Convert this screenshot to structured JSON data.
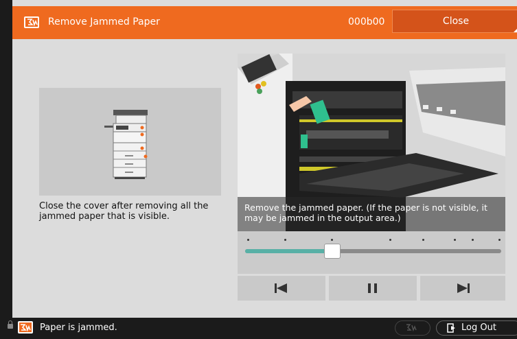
{
  "header": {
    "title": "Remove Jammed Paper",
    "code": "000b00",
    "close_label": "Close",
    "accent_color": "#ef6a1f"
  },
  "instruction": {
    "text": "Close the cover after removing all the jammed paper that is visible."
  },
  "animation": {
    "caption": "Remove the jammed paper. (If the paper is not visible, it may be jammed in the output area.)",
    "progress": 0.34,
    "step_markers": 9,
    "controls": [
      "previous-step-icon",
      "pause-icon",
      "next-step-icon"
    ]
  },
  "statusbar": {
    "message": "Paper is jammed.",
    "logout_label": "Log Out"
  }
}
